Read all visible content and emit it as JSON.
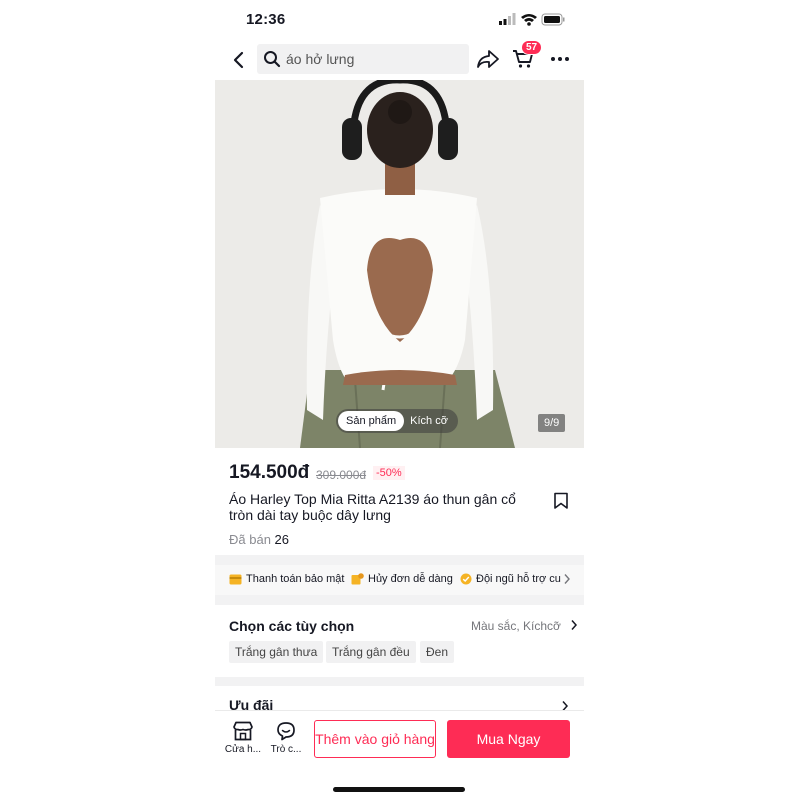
{
  "status_bar": {
    "time": "12:36"
  },
  "header": {
    "search_text": "áo hở lưng",
    "cart_count": "57"
  },
  "gallery": {
    "tab_product": "Sản phẩm",
    "tab_size": "Kích cỡ",
    "counter": "9/9"
  },
  "product": {
    "price": "154.500đ",
    "old_price": "309.000đ",
    "discount": "-50%",
    "title": "Áo Harley Top Mia Ritta A2139 áo thun gân cổ tròn dài tay buộc dây lưng",
    "sold_label": "Đã bán",
    "sold_count": "26"
  },
  "features": [
    "Thanh toán bảo mật",
    "Hủy đơn dễ dàng",
    "Đội ngũ hỗ trợ cu"
  ],
  "options": {
    "title": "Chọn các tùy chọn",
    "hint": "Màu sắc, Kíchcỡ",
    "chips": [
      "Trắng gân thưa",
      "Trắng gân đều",
      "Đen"
    ]
  },
  "offers": {
    "title": "Ưu đãi"
  },
  "bottom_bar": {
    "shop_label": "Cửa h...",
    "chat_label": "Trò c...",
    "add_to_cart": "Thêm vào giỏ hàng",
    "buy_now": "Mua Ngay"
  },
  "colors": {
    "accent": "#fe2c55",
    "text": "#161823"
  }
}
